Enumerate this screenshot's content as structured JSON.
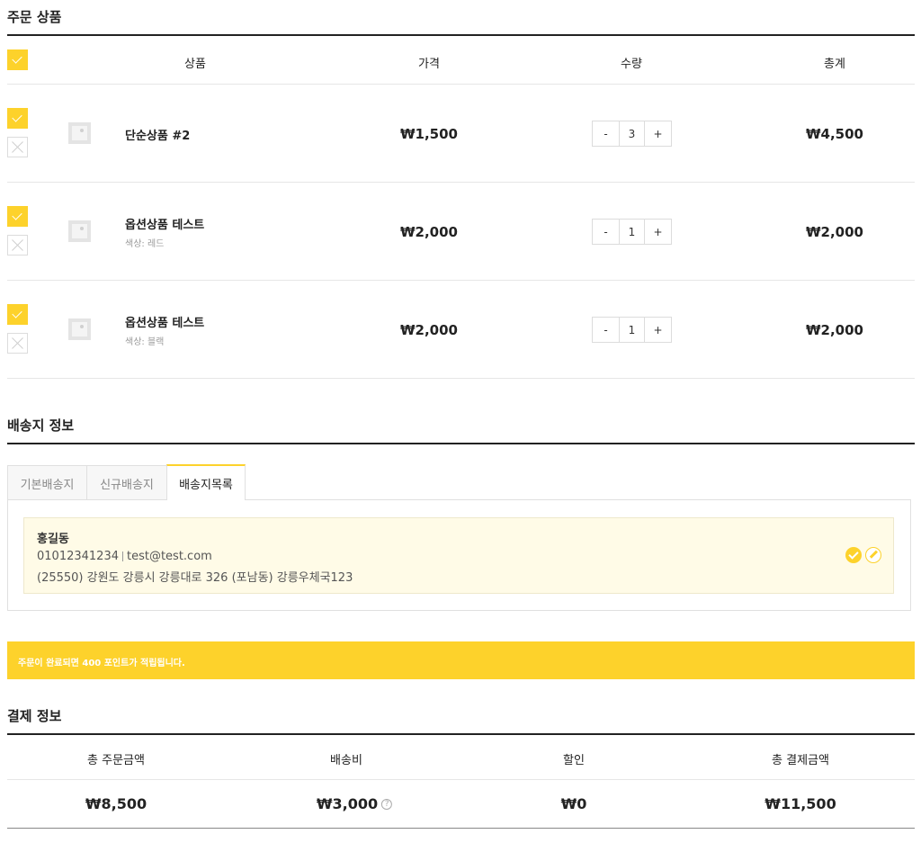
{
  "order": {
    "title": "주문 상품",
    "columns": {
      "product": "상품",
      "price": "가격",
      "quantity": "수량",
      "total": "총계"
    },
    "items": [
      {
        "name": "단순상품 #2",
        "option": "",
        "price": "₩1,500",
        "qty": "3",
        "total": "₩4,500"
      },
      {
        "name": "옵션상품 테스트",
        "option": "색상: 레드",
        "price": "₩2,000",
        "qty": "1",
        "total": "₩2,000"
      },
      {
        "name": "옵션상품 테스트",
        "option": "색상: 블랙",
        "price": "₩2,000",
        "qty": "1",
        "total": "₩2,000"
      }
    ],
    "minus_label": "-",
    "plus_label": "+"
  },
  "shipping": {
    "title": "배송지 정보",
    "tabs": [
      {
        "label": "기본배송지",
        "active": false
      },
      {
        "label": "신규배송지",
        "active": false
      },
      {
        "label": "배송지목록",
        "active": true
      }
    ],
    "address": {
      "name": "홍길동",
      "phone": "01012341234",
      "email": "test@test.com",
      "full": "(25550) 강원도 강릉시 강릉대로 326 (포남동) 강릉우체국123"
    }
  },
  "points_notice": "주문이 완료되면 400 포인트가 적립됩니다.",
  "payment": {
    "title": "결제 정보",
    "columns": {
      "order_total": "총 주문금액",
      "shipping": "배송비",
      "discount": "할인",
      "grand_total": "총 결제금액"
    },
    "values": {
      "order_total": "₩8,500",
      "shipping": "₩3,000",
      "discount": "₩0",
      "grand_total": "₩11,500"
    }
  },
  "colors": {
    "accent": "#fdd22b",
    "card_bg": "#fffbe7",
    "text": "#222222"
  },
  "icons": {
    "checkbox": "check-icon",
    "remove": "close-icon",
    "thumbnail": "image-placeholder-icon",
    "edit": "pencil-icon",
    "help": "question-icon"
  }
}
